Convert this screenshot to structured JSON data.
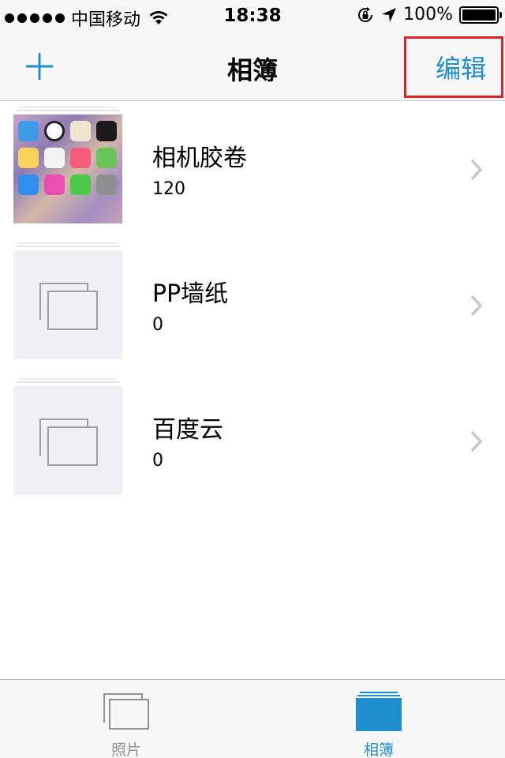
{
  "status_bar": {
    "carrier": "中国移动",
    "time": "18:38",
    "battery": "100%",
    "icons": [
      "signal-dots-icon",
      "wifi-icon",
      "rotation-lock-icon",
      "location-arrow-icon",
      "battery-icon"
    ]
  },
  "nav": {
    "title": "相簿",
    "add_icon": "plus-icon",
    "edit_label": "编辑"
  },
  "albums": [
    {
      "name": "相机胶卷",
      "count": "120",
      "thumb": "photo-thumbnail"
    },
    {
      "name": "PP墙纸",
      "count": "0",
      "thumb": "empty-album-icon"
    },
    {
      "name": "百度云",
      "count": "0",
      "thumb": "empty-album-icon"
    }
  ],
  "tabs": [
    {
      "label": "照片",
      "icon": "photos-icon",
      "selected": false
    },
    {
      "label": "相簿",
      "icon": "albums-icon",
      "selected": true
    }
  ],
  "colors": {
    "accent": "#1f8ecf",
    "highlight_box": "#d9252b",
    "bar_bg": "#f7f7f7",
    "thumb_bg": "#efeff4"
  }
}
